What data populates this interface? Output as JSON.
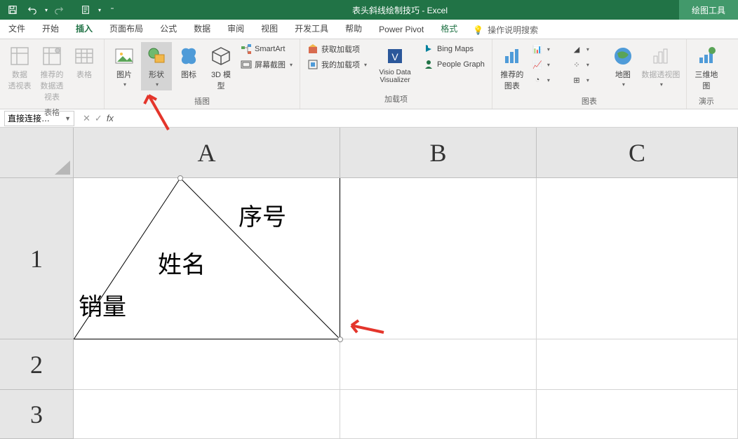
{
  "title": "表头斜线绘制技巧 - Excel",
  "contextTab": "绘图工具",
  "tabs": {
    "file": "文件",
    "home": "开始",
    "insert": "插入",
    "layout": "页面布局",
    "formula": "公式",
    "data": "数据",
    "review": "审阅",
    "view": "视图",
    "dev": "开发工具",
    "help": "帮助",
    "powerpivot": "Power Pivot",
    "format": "格式"
  },
  "tellMe": "操作说明搜索",
  "ribbon": {
    "tables": {
      "pivot": "数据\n透视表",
      "recommended": "推荐的\n数据透视表",
      "table": "表格",
      "label": "表格"
    },
    "illustrations": {
      "picture": "图片",
      "shapes": "形状",
      "icons": "图标",
      "model3d": "3D 模\n型",
      "smartart": "SmartArt",
      "screenshot": "屏幕截图",
      "label": "插图"
    },
    "addins": {
      "get": "获取加载项",
      "my": "我的加载项",
      "visio": "Visio Data\nVisualizer",
      "bing": "Bing Maps",
      "people": "People Graph",
      "label": "加载项"
    },
    "charts": {
      "recommended": "推荐的\n图表",
      "maps": "地图",
      "pivotchart": "数据透视图",
      "label": "图表"
    },
    "demo": {
      "map3d": "三维地\n图",
      "label": "演示"
    }
  },
  "nameBox": "直接连接…",
  "cols": {
    "A": "A",
    "B": "B",
    "C": "C"
  },
  "rows": {
    "r1": "1",
    "r2": "2",
    "r3": "3"
  },
  "cellA1": {
    "topRight": "序号",
    "middle": "姓名",
    "bottomLeft": "销量"
  }
}
